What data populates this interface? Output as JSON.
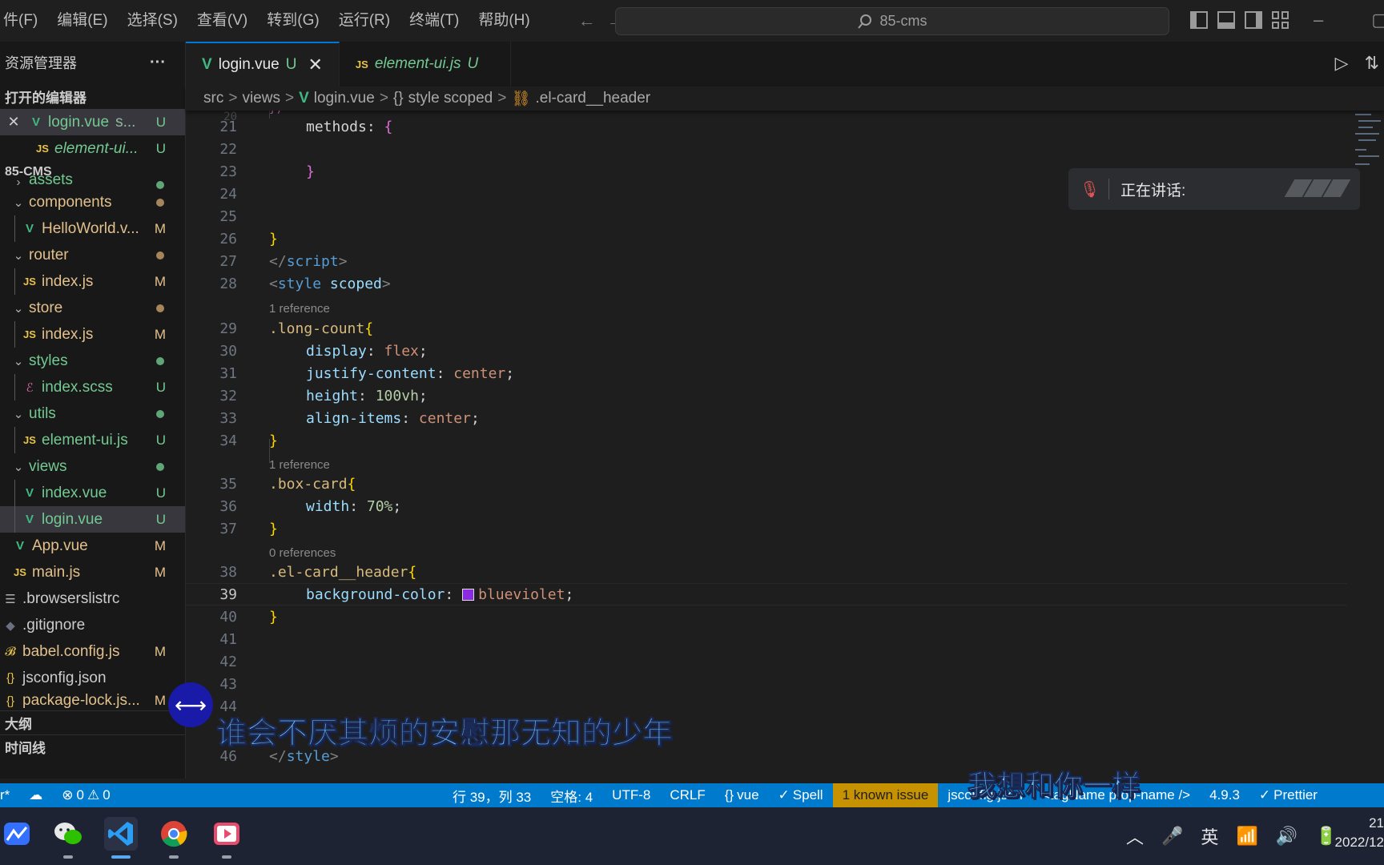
{
  "titlebar": {
    "menu": [
      "件(F)",
      "编辑(E)",
      "选择(S)",
      "查看(V)",
      "转到(G)",
      "运行(R)",
      "终端(T)",
      "帮助(H)"
    ],
    "back_arrow": "←",
    "forward_arrow": "→",
    "search_text": "85-cms"
  },
  "sidebar": {
    "explorer_title": "资源管理器",
    "more_label": "···",
    "open_editors_title": "打开的编辑器",
    "open_editors": [
      {
        "close": "✕",
        "name": "login.vue",
        "suffix": "s...",
        "status": "U"
      },
      {
        "name": "element-ui...",
        "status": "U"
      }
    ],
    "project_title": "85-CMS",
    "tree": [
      {
        "name": "assets"
      },
      {
        "name": "components"
      },
      {
        "name": "HelloWorld.v...",
        "status": "M"
      },
      {
        "name": "router"
      },
      {
        "name": "index.js",
        "status": "M"
      },
      {
        "name": "store"
      },
      {
        "name": "index.js",
        "status": "M"
      },
      {
        "name": "styles"
      },
      {
        "name": "index.scss",
        "status": "U"
      },
      {
        "name": "utils"
      },
      {
        "name": "element-ui.js",
        "status": "U"
      },
      {
        "name": "views"
      },
      {
        "name": "index.vue",
        "status": "U"
      },
      {
        "name": "login.vue",
        "status": "U"
      },
      {
        "name": "App.vue",
        "status": "M"
      },
      {
        "name": "main.js",
        "status": "M"
      },
      {
        "name": ".browserslistrc"
      },
      {
        "name": ".gitignore"
      },
      {
        "name": "babel.config.js",
        "status": "M"
      },
      {
        "name": "jsconfig.json"
      },
      {
        "name": "package-lock.js...",
        "status": "M"
      }
    ],
    "outline_title": "大纲",
    "timeline_title": "时间线"
  },
  "tabs": [
    {
      "name": "login.vue",
      "status": "U",
      "close": "✕"
    },
    {
      "name": "element-ui.js",
      "status": "U"
    }
  ],
  "breadcrumb": {
    "parts": [
      "src",
      "views",
      "login.vue",
      "style scoped",
      ".el-card__header"
    ],
    "sep": ">"
  },
  "editor": {
    "lines": [
      {
        "n": "21",
        "code": [
          "methods",
          ": ",
          "{"
        ]
      },
      {
        "n": "22"
      },
      {
        "n": "23",
        "code": [
          "}"
        ]
      },
      {
        "n": "24"
      },
      {
        "n": "25"
      },
      {
        "n": "26",
        "code": [
          "}"
        ]
      },
      {
        "n": "27",
        "code": [
          "</",
          "script",
          ">"
        ]
      },
      {
        "n": "28",
        "code": [
          "<",
          "style",
          " scoped",
          ">"
        ]
      },
      {
        "n": "29",
        "code": [
          ".long-count",
          "{"
        ]
      },
      {
        "n": "30",
        "code": [
          "display",
          ": ",
          "flex",
          ";"
        ]
      },
      {
        "n": "31",
        "code": [
          "justify-content",
          ": ",
          "center",
          ";"
        ]
      },
      {
        "n": "32",
        "code": [
          "height",
          ": ",
          "100vh",
          ";"
        ]
      },
      {
        "n": "33",
        "code": [
          "align-items",
          ": ",
          "center",
          ";"
        ]
      },
      {
        "n": "34",
        "code": [
          "}"
        ]
      },
      {
        "n": "35",
        "code": [
          ".box-card",
          "{"
        ]
      },
      {
        "n": "36",
        "code": [
          "width",
          ": ",
          "70%",
          ";"
        ]
      },
      {
        "n": "37",
        "code": [
          "}"
        ]
      },
      {
        "n": "38",
        "code": [
          ".el-card__header",
          "{"
        ]
      },
      {
        "n": "39",
        "code": [
          "background-color",
          ": ",
          "blueviolet",
          ";"
        ]
      },
      {
        "n": "40",
        "code": [
          "}"
        ]
      },
      {
        "n": "41"
      },
      {
        "n": "42"
      },
      {
        "n": "43"
      },
      {
        "n": "44"
      },
      {
        "n": "46",
        "code": [
          "</",
          "style",
          ">"
        ]
      }
    ],
    "codelens": [
      "1 reference",
      "1 reference",
      "0 references"
    ],
    "swatch_color": "#8a2be2"
  },
  "voice": {
    "speaking_label": "正在讲话:"
  },
  "subtitles": {
    "line1": "谁会不厌其烦的安慰那无知的少年",
    "line2": "我想和你一样"
  },
  "statusbar": {
    "left": [
      "r*",
      "0",
      "0"
    ],
    "position": "行 39，列 33",
    "spaces": "空格: 4",
    "encoding": "UTF-8",
    "eol": "CRLF",
    "language": "vue",
    "spell": "Spell",
    "known_issue": "1 known issue",
    "jsconfig": "jsconfig.json",
    "tagname": "<tagName prop-name />",
    "ts_version": "4.9.3",
    "prettier": "Prettier"
  },
  "taskbar": {
    "ime": "英",
    "time": "21",
    "date": "2022/12"
  }
}
